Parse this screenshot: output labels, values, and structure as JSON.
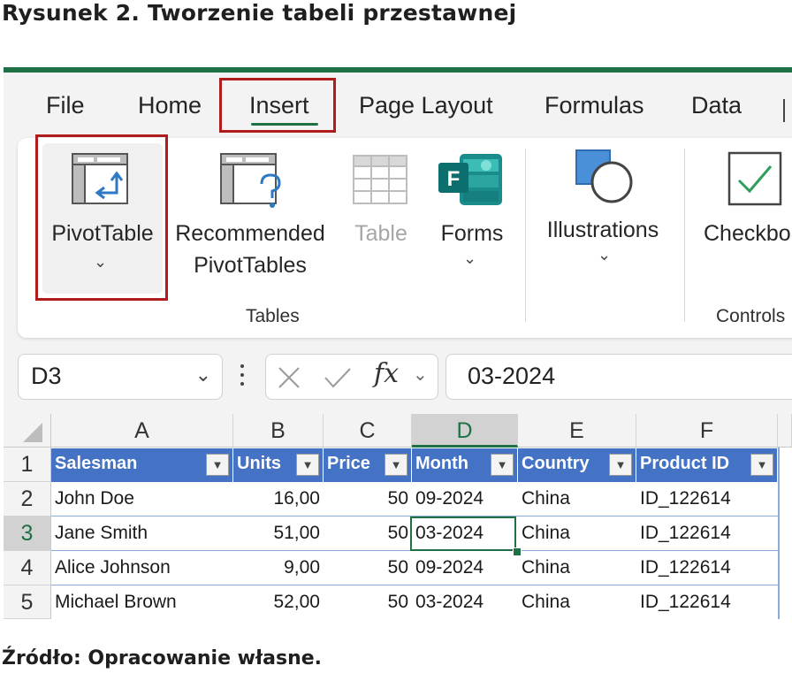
{
  "figure": {
    "title": "Rysunek 2. Tworzenie tabeli przestawnej",
    "source": "Źródło: Opracowanie własne."
  },
  "menu": {
    "tabs": [
      "File",
      "Home",
      "Insert",
      "Page Layout",
      "Formulas",
      "Data"
    ],
    "active_tab": "Insert"
  },
  "ribbon": {
    "pivottable": "PivotTable",
    "recommended_line1": "Recommended",
    "recommended_line2": "PivotTables",
    "table": "Table",
    "forms": "Forms",
    "illustrations": "Illustrations",
    "checkbox": "Checkbo",
    "group_tables": "Tables",
    "group_controls": "Controls"
  },
  "formula_bar": {
    "name_box": "D3",
    "fx": "fx",
    "value": "03-2024"
  },
  "sheet": {
    "columns": [
      "A",
      "B",
      "C",
      "D",
      "E",
      "F"
    ],
    "rows": [
      "1",
      "2",
      "3",
      "4",
      "5"
    ],
    "selected_column": "D",
    "selected_row": "3",
    "headers": [
      "Salesman",
      "Units",
      "Price",
      "Month",
      "Country",
      "Product ID"
    ],
    "data": [
      [
        "John Doe",
        "16,00",
        "50",
        "09-2024",
        "China",
        "ID_122614"
      ],
      [
        "Jane Smith",
        "51,00",
        "50",
        "03-2024",
        "China",
        "ID_122614"
      ],
      [
        "Alice Johnson",
        "9,00",
        "50",
        "09-2024",
        "China",
        "ID_122614"
      ],
      [
        "Michael Brown",
        "52,00",
        "50",
        "03-2024",
        "China",
        "ID_122614"
      ]
    ]
  },
  "colors": {
    "excel_green": "#1e7145",
    "table_header_blue": "#4472c4",
    "highlight_red": "#b01b1b"
  }
}
